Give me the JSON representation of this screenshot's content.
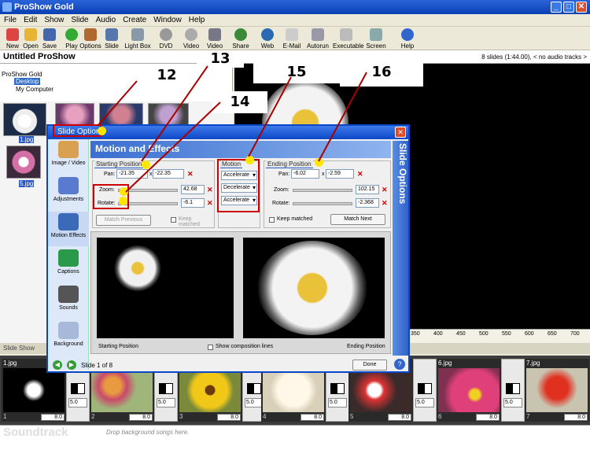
{
  "app": {
    "title": "ProShow Gold"
  },
  "menu": [
    "File",
    "Edit",
    "Show",
    "Slide",
    "Audio",
    "Create",
    "Window",
    "Help"
  ],
  "toolbar": [
    "New",
    "Open",
    "Save",
    "Play",
    "Options",
    "Slide",
    "Light Box",
    "DVD Disc",
    "Video CD",
    "Video",
    "Share Show",
    "Web Show",
    "E-Mail",
    "Autorun CD",
    "Executable",
    "Screen Saver",
    "Help"
  ],
  "project": {
    "name": "Untitled ProShow",
    "info": "8 slides (1:44.00), < no audio tracks >"
  },
  "tree": {
    "root": "ProShow Gold",
    "desktop": "Desktop",
    "computer": "My Computer"
  },
  "files": [
    {
      "name": "1.jpg"
    },
    {
      "name": "5.jpg"
    }
  ],
  "callouts": [
    "12",
    "13",
    "14",
    "15",
    "16"
  ],
  "dialog": {
    "title": "Slide Options",
    "header": "Motion and Effects",
    "vertical_title": "Slide Options",
    "sidebar": [
      "Image / Video",
      "Adjustments",
      "Motion Effects",
      "Captions",
      "Sounds",
      "Background"
    ],
    "start": {
      "title": "Starting Position",
      "pan_label": "Pan:",
      "pan_x": "-21.35",
      "pan_sep": "x",
      "pan_y": "-22.35",
      "zoom_label": "Zoom:",
      "zoom": "42.68",
      "rotate_label": "Rotate:",
      "rotate": "-6.1",
      "match_prev": "Match Previous",
      "keep": "Keep matched"
    },
    "motion": {
      "title": "Motion",
      "pan": "Accelerate",
      "zoom": "Decelerate",
      "rotate": "Accelerate"
    },
    "end": {
      "title": "Ending Position",
      "pan_label": "Pan:",
      "pan_x": "-6.02",
      "pan_sep": "x",
      "pan_y": "-2.59",
      "zoom_label": "Zoom:",
      "zoom": "102.15",
      "rotate_label": "Rotate:",
      "rotate": "-2.368",
      "keep": "Keep matched",
      "match_next": "Match Next"
    },
    "preview": {
      "start_label": "Starting Position",
      "composition": "Show composition lines",
      "end_label": "Ending Position"
    },
    "footer": {
      "slide_counter": "Slide 1 of 8",
      "done": "Done"
    }
  },
  "ruler": [
    "350",
    "400",
    "450",
    "500",
    "550",
    "600",
    "650",
    "700"
  ],
  "slide_show_label": "Slide Show",
  "timeline": [
    {
      "name": "1.jpg",
      "dur": "8.0",
      "num": "1"
    },
    {
      "name": "",
      "dur": "8.0",
      "num": "2"
    },
    {
      "name": "",
      "dur": "8.0",
      "num": "3"
    },
    {
      "name": "",
      "dur": "8.0",
      "num": "4"
    },
    {
      "name": "",
      "dur": "8.0",
      "num": "5"
    },
    {
      "name": "6.jpg",
      "dur": "8.0",
      "num": "6"
    },
    {
      "name": "7.jpg",
      "dur": "8.0",
      "num": "7"
    }
  ],
  "transitions": [
    "5.0",
    "5.0",
    "5.0",
    "5.0",
    "5.0",
    "5.0"
  ],
  "soundtrack": {
    "label": "Soundtrack",
    "hint": "Drop background songs here."
  }
}
